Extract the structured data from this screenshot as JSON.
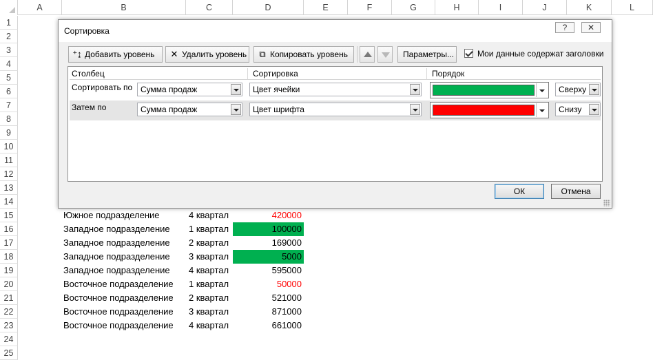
{
  "sheet": {
    "columns": [
      "A",
      "B",
      "C",
      "D",
      "E",
      "F",
      "G",
      "H",
      "I",
      "J",
      "K",
      "L"
    ],
    "row_numbers": [
      "1",
      "2",
      "3",
      "4",
      "5",
      "6",
      "7",
      "8",
      "9",
      "10",
      "11",
      "12",
      "13",
      "14",
      "15",
      "16",
      "17",
      "18",
      "19",
      "20",
      "21",
      "22",
      "23",
      "24",
      "25"
    ],
    "visible_rows": [
      {
        "row": "15",
        "b": "Южное подразделение",
        "c": "4 квартал",
        "d": "420000",
        "d_style": "red"
      },
      {
        "row": "16",
        "b": "Западное подразделение",
        "c": "1 квартал",
        "d": "100000",
        "d_style": "green"
      },
      {
        "row": "17",
        "b": "Западное подразделение",
        "c": "2 квартал",
        "d": "169000",
        "d_style": "normal"
      },
      {
        "row": "18",
        "b": "Западное подразделение",
        "c": "3 квартал",
        "d": "5000",
        "d_style": "green"
      },
      {
        "row": "19",
        "b": "Западное подразделение",
        "c": "4 квартал",
        "d": "595000",
        "d_style": "normal"
      },
      {
        "row": "20",
        "b": "Восточное подразделение",
        "c": "1 квартал",
        "d": "50000",
        "d_style": "red"
      },
      {
        "row": "21",
        "b": "Восточное подразделение",
        "c": "2 квартал",
        "d": "521000",
        "d_style": "normal"
      },
      {
        "row": "22",
        "b": "Восточное подразделение",
        "c": "3 квартал",
        "d": "871000",
        "d_style": "normal"
      },
      {
        "row": "23",
        "b": "Восточное подразделение",
        "c": "4 квартал",
        "d": "661000",
        "d_style": "normal"
      }
    ],
    "colors": {
      "green_fill": "#00b050",
      "red_font": "#ff0000"
    }
  },
  "dialog": {
    "title": "Сортировка",
    "help_label": "?",
    "close_label": "✕",
    "toolbar": {
      "add_level": "Добавить уровень",
      "delete_level": "Удалить уровень",
      "copy_level": "Копировать уровень",
      "parameters": "Параметры...",
      "headers_checkbox": "Мои данные содержат заголовки",
      "headers_checked": true
    },
    "headers": {
      "column": "Столбец",
      "sort_on": "Сортировка",
      "order": "Порядок"
    },
    "levels": [
      {
        "label": "Сортировать по",
        "column": "Сумма продаж",
        "sort_on": "Цвет ячейки",
        "color": "#00b050",
        "position": "Сверху"
      },
      {
        "label": "Затем по",
        "column": "Сумма продаж",
        "sort_on": "Цвет шрифта",
        "color": "#ff0000",
        "position": "Снизу"
      }
    ],
    "ok": "ОК",
    "cancel": "Отмена"
  }
}
